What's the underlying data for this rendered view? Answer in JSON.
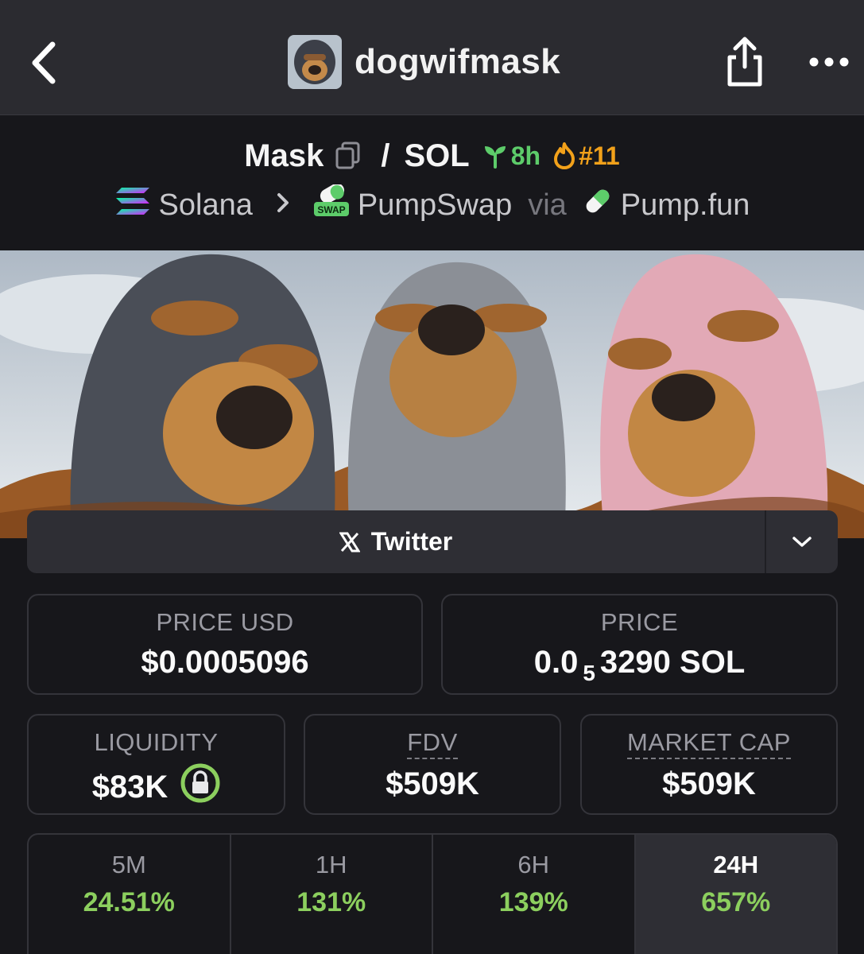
{
  "nav": {
    "title": "dogwifmask"
  },
  "pair": {
    "base": "Mask",
    "separator": "/",
    "quote": "SOL",
    "age": "8h",
    "rank": "#11",
    "chain": "Solana",
    "dex": "PumpSwap",
    "via": "via",
    "launchpad": "Pump.fun"
  },
  "social": {
    "twitter_label": "Twitter"
  },
  "stats": {
    "price_usd_label": "PRICE USD",
    "price_usd_value": "$0.0005096",
    "price_label": "PRICE",
    "price_prefix": "0.0",
    "price_zeros": "5",
    "price_suffix": "3290 SOL",
    "liquidity_label": "LIQUIDITY",
    "liquidity_value": "$83K",
    "fdv_label": "FDV",
    "fdv_value": "$509K",
    "mcap_label": "MARKET CAP",
    "mcap_value": "$509K"
  },
  "timeframes": [
    {
      "label": "5M",
      "value": "24.51%"
    },
    {
      "label": "1H",
      "value": "131%"
    },
    {
      "label": "6H",
      "value": "139%"
    },
    {
      "label": "24H",
      "value": "657%"
    }
  ],
  "colors": {
    "accent_green": "#5dcc6a",
    "rank_orange": "#f2a11a",
    "change_green": "#8ccf5e"
  }
}
